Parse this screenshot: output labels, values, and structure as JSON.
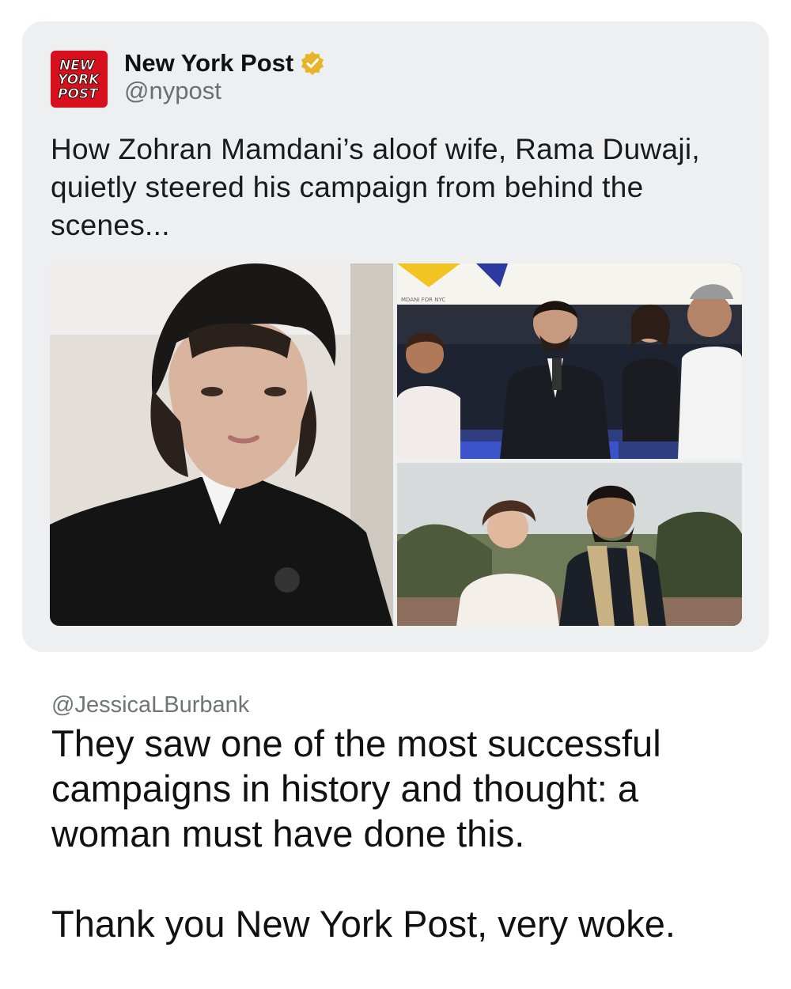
{
  "quoted_post": {
    "logo": {
      "label": "NEW YORK POST",
      "color": "#d6101c"
    },
    "author_name": "New York Post",
    "verified_icon": "verified-badge-icon",
    "verified_color": "#e8b52a",
    "handle": "@nypost",
    "headline": "How Zohran Mamdani’s aloof wife, Rama Duwaji, quietly steered his campaign from behind the scenes...",
    "photos": [
      {
        "name": "portrait-photo"
      },
      {
        "name": "rally-photo",
        "sign_text": "MDANI FOR NYC"
      },
      {
        "name": "wedding-photo"
      }
    ],
    "card_color": "#edeff1"
  },
  "reply": {
    "handle": "@JessicaLBurbank",
    "text": "They saw one of the most successful campaigns in history and thought: a woman must have done this.\n\nThank you New York Post, very woke."
  }
}
